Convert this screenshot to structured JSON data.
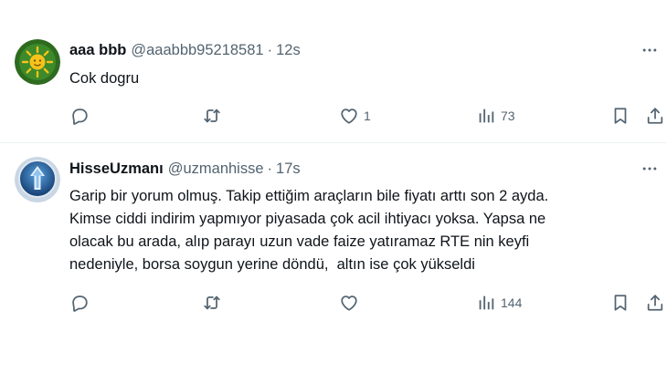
{
  "tweets": [
    {
      "display_name": "aaa bbb",
      "handle": "@aaabbb95218581",
      "separator": "·",
      "time": "12s",
      "text_lines": [
        "Cok dogru"
      ],
      "reply_count": "",
      "retweet_count": "",
      "like_count": "1",
      "view_count": "73",
      "avatar": {
        "icon": "sun-avatar-icon",
        "bg_color": "#2e6b1f",
        "sun_color": "#f7c21b"
      }
    },
    {
      "display_name": "HisseUzmanı",
      "handle": "@uzmanhisse",
      "separator": "·",
      "time": "17s",
      "text_lines": [
        "Garip bir yorum olmuş. Takip ettiğim araçların bile fiyatı arttı son 2 ayda.",
        "Kimse ciddi indirim yapmıyor piyasada çok acil ihtiyacı yoksa. Yapsa ne",
        "olacak bu arada, alıp parayı uzun vade faize yatıramaz RTE nin keyfi",
        "nedeniyle, borsa soygun yerine döndü,  altın ise çok yükseldi"
      ],
      "reply_count": "",
      "retweet_count": "",
      "like_count": "",
      "view_count": "144",
      "avatar": {
        "icon": "arrow-up-avatar-icon",
        "bg_color": "#1d4e8a",
        "arrow_color": "#e8f2fb"
      }
    }
  ],
  "colors": {
    "text": "#0f1419",
    "muted": "#536471",
    "divider": "#eff3f4"
  },
  "icons": [
    "more-icon",
    "reply-icon",
    "retweet-icon",
    "like-icon",
    "views-icon",
    "bookmark-icon",
    "share-icon"
  ]
}
